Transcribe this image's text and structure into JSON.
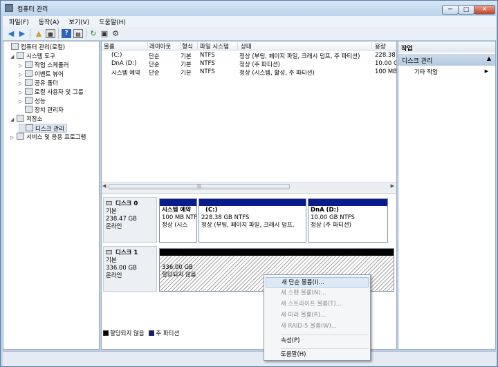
{
  "window": {
    "title": "컴퓨터 관리",
    "min": "─",
    "max": "□",
    "close": "✕"
  },
  "menu": [
    "파일(F)",
    "동작(A)",
    "보기(V)",
    "도움말(H)"
  ],
  "tree": [
    {
      "label": "컴퓨터 관리(로컬)",
      "icon": "computer-icon"
    },
    {
      "label": "시스템 도구",
      "icon": "tools-icon"
    },
    {
      "label": "작업 스케줄러",
      "icon": "clock-icon"
    },
    {
      "label": "이벤트 뷰어",
      "icon": "event-viewer-icon"
    },
    {
      "label": "공유 폴더",
      "icon": "shared-folder-icon"
    },
    {
      "label": "로컬 사용자 및 그룹",
      "icon": "users-icon"
    },
    {
      "label": "성능",
      "icon": "performance-icon"
    },
    {
      "label": "장치 관리자",
      "icon": "device-manager-icon"
    },
    {
      "label": "저장소",
      "icon": "storage-icon"
    },
    {
      "label": "디스크 관리",
      "icon": "disk-management-icon"
    },
    {
      "label": "서비스 및 응용 프로그램",
      "icon": "services-icon"
    }
  ],
  "volume_headers": [
    "볼륨",
    "레이아웃",
    "형식",
    "파일 시스템",
    "상태",
    "용량"
  ],
  "volumes": [
    [
      "(C:)",
      "단순",
      "기본",
      "NTFS",
      "정상 (부팅, 페이지 파일, 크래시 덤프, 주 파티션)",
      "228.38 "
    ],
    [
      "DnA (D:)",
      "단순",
      "기본",
      "NTFS",
      "정상 (주 파티션)",
      "10.00 G"
    ],
    [
      "시스템 예약",
      "단순",
      "기본",
      "NTFS",
      "정상 (시스템, 활성, 주 파티션)",
      "100 MB"
    ]
  ],
  "disk0": {
    "name": "디스크 0",
    "type": "기본",
    "size": "238.47 GB",
    "status": "온라인",
    "parts": [
      {
        "name": "시스템 예약",
        "size": "100 MB NTF",
        "status": "정상 (시스"
      },
      {
        "name": "(C:)",
        "size": "228.38 GB NTFS",
        "status": "정상 (부팅, 페이지 파일, 크래시 덤프,"
      },
      {
        "name": "DnA  (D:)",
        "size": "10.00 GB NTFS",
        "status": "정상 (주 파티션)"
      }
    ]
  },
  "disk1": {
    "name": "디스크 1",
    "type": "기본",
    "size": "336.00 GB",
    "status": "온라인",
    "unalloc_size": "336.00 GB",
    "unalloc_label": "할당되지 않음"
  },
  "legend": {
    "unalloc": "할당되지 않음",
    "primary": "주 파티션"
  },
  "actions": {
    "header": "작업",
    "section": "디스크 관리",
    "caret": "▲",
    "item": "기타 작업"
  },
  "context_menu": [
    {
      "label": "새 단순 볼륨(I)...",
      "disabled": false
    },
    {
      "label": "새 스팬 볼륨(N)...",
      "disabled": true
    },
    {
      "label": "새 스트라이프 볼륨(T)...",
      "disabled": true
    },
    {
      "label": "새 미러 볼륨(R)...",
      "disabled": true
    },
    {
      "label": "새 RAID-5 볼륨(W)...",
      "disabled": true
    },
    {
      "label": "속성(P)",
      "disabled": false
    },
    {
      "label": "도움말(H)",
      "disabled": false
    }
  ],
  "colors": {
    "primary_partition": "#0a1c8c",
    "unallocated": "#000000",
    "selection": "#dde6f1"
  }
}
